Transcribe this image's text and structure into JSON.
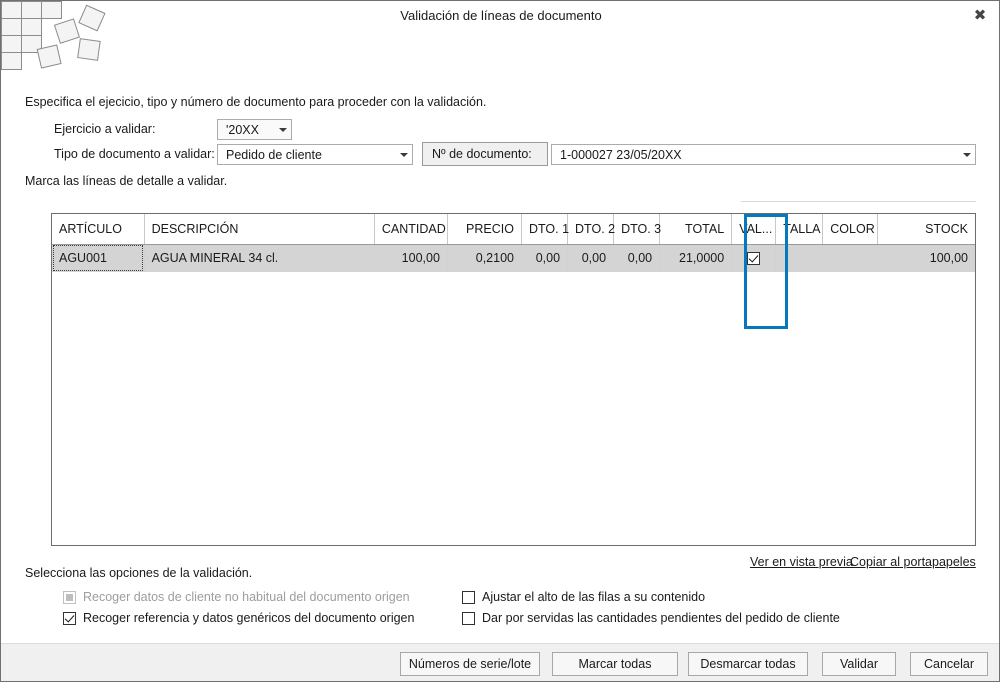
{
  "window": {
    "title": "Validación de líneas de documento",
    "close_label": "✖"
  },
  "instructions": {
    "intro": "Especifica el ejecicio, tipo y número de documento para proceder con la validación.",
    "marca": "Marca las líneas de detalle a validar.",
    "options": "Selecciona las opciones de la validación."
  },
  "form": {
    "ejercicio_label": "Ejercicio a validar:",
    "ejercicio_value": "'20XX",
    "tipo_label": "Tipo de documento a validar:",
    "tipo_value": "Pedido de cliente",
    "numdoc_button": "Nº de documento:",
    "numdoc_value": "1-000027   23/05/20XX"
  },
  "grid": {
    "columns": [
      "ARTÍCULO",
      "DESCRIPCIÓN",
      "CANTIDAD",
      "PRECIO",
      "DTO. 1",
      "DTO. 2",
      "DTO. 3",
      "TOTAL",
      "VAL...",
      "TALLA",
      "COLOR",
      "STOCK"
    ],
    "rows": [
      {
        "articulo": "AGU001",
        "descripcion": "AGUA MINERAL 34 cl.",
        "cantidad": "100,00",
        "precio": "0,2100",
        "dto1": "0,00",
        "dto2": "0,00",
        "dto3": "0,00",
        "total": "21,0000",
        "validada": true,
        "talla": "",
        "color": "",
        "stock": "100,00"
      }
    ],
    "highlight_color": "#0878bd"
  },
  "links": {
    "preview": "Ver en vista previa",
    "copy": "Copiar al portapapeles"
  },
  "options": [
    {
      "label": "Recoger datos de cliente no habitual del documento origen",
      "checked": false,
      "disabled": true
    },
    {
      "label": "Recoger referencia y datos genéricos del documento origen",
      "checked": true,
      "disabled": false
    },
    {
      "label": "Ajustar el alto de las filas a su contenido",
      "checked": false,
      "disabled": false
    },
    {
      "label": "Dar por servidas las cantidades pendientes del pedido de cliente",
      "checked": false,
      "disabled": false
    }
  ],
  "buttons": {
    "serie": "Números de serie/lote",
    "marcar": "Marcar todas",
    "desmarcar": "Desmarcar todas",
    "validar": "Validar",
    "cancelar": "Cancelar"
  }
}
